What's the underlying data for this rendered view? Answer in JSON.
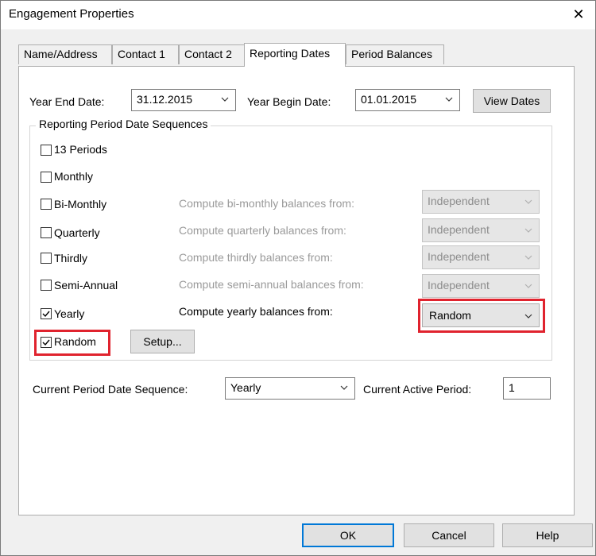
{
  "window": {
    "title": "Engagement Properties",
    "close_glyph": "✕"
  },
  "tabs": [
    {
      "label": "Name/Address"
    },
    {
      "label": "Contact 1"
    },
    {
      "label": "Contact 2"
    },
    {
      "label": "Reporting Dates",
      "active": true
    },
    {
      "label": "Period Balances"
    }
  ],
  "dates": {
    "year_end_label": "Year End Date:",
    "year_end_value": "31.12.2015",
    "year_begin_label": "Year Begin Date:",
    "year_begin_value": "01.01.2015",
    "view_dates_label": "View Dates"
  },
  "sequences": {
    "group_title": "Reporting Period Date Sequences",
    "items": [
      {
        "label": "13 Periods",
        "checked": false
      },
      {
        "label": "Monthly",
        "checked": false
      },
      {
        "label": "Bi-Monthly",
        "checked": false,
        "compute_label": "Compute bi-monthly balances from:",
        "compute_value": "Independent",
        "enabled": false
      },
      {
        "label": "Quarterly",
        "checked": false,
        "compute_label": "Compute quarterly balances from:",
        "compute_value": "Independent",
        "enabled": false
      },
      {
        "label": "Thirdly",
        "checked": false,
        "compute_label": "Compute thirdly balances from:",
        "compute_value": "Independent",
        "enabled": false
      },
      {
        "label": "Semi-Annual",
        "checked": false,
        "compute_label": "Compute semi-annual balances from:",
        "compute_value": "Independent",
        "enabled": false
      },
      {
        "label": "Yearly",
        "checked": true,
        "compute_label": "Compute yearly balances from:",
        "compute_value": "Random",
        "enabled": true
      },
      {
        "label": "Random",
        "checked": true
      }
    ],
    "setup_label": "Setup..."
  },
  "current": {
    "sequence_label": "Current Period Date Sequence:",
    "sequence_value": "Yearly",
    "active_period_label": "Current Active Period:",
    "active_period_value": "1"
  },
  "buttons": {
    "ok": "OK",
    "cancel": "Cancel",
    "help": "Help"
  },
  "colors": {
    "highlight": "#e0232e",
    "default_button_border": "#0078d7",
    "disabled_text": "#9a9a9a"
  }
}
